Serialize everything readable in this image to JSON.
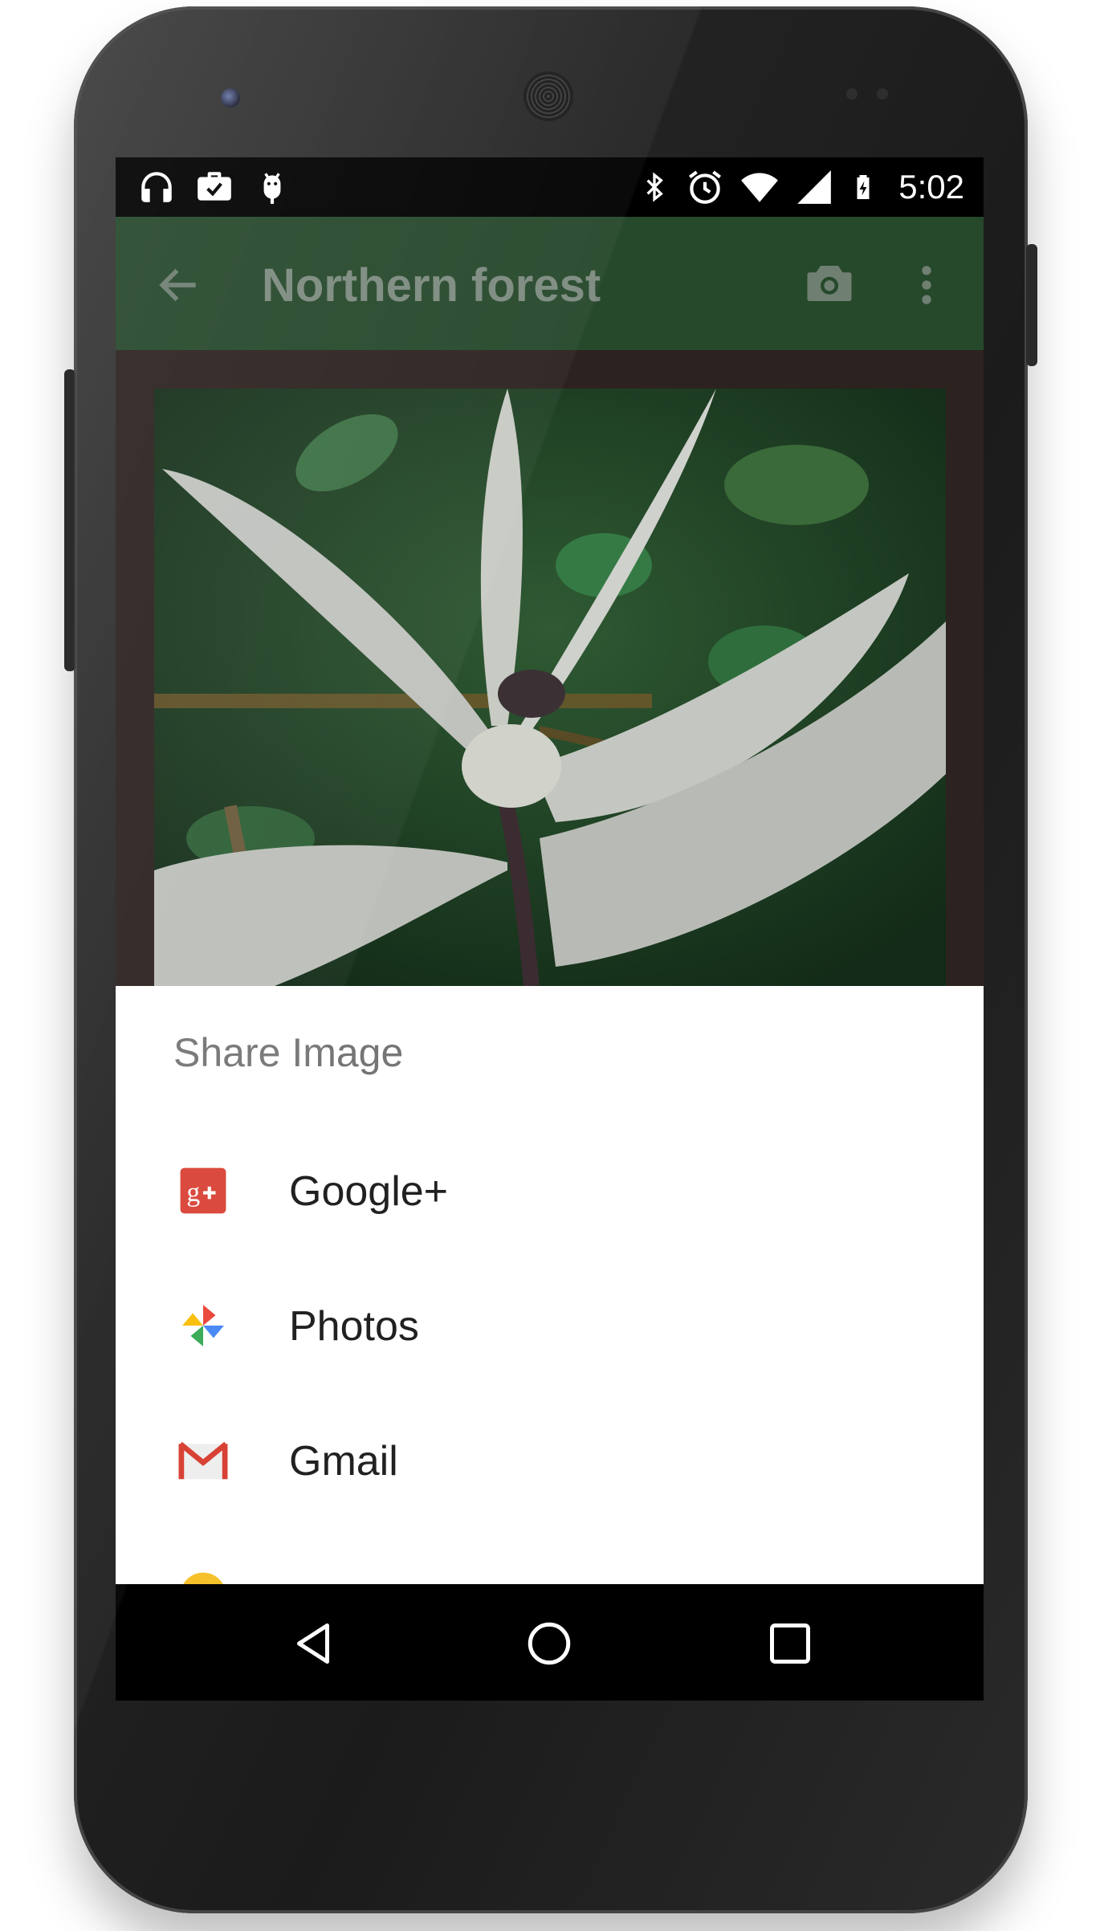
{
  "status_bar": {
    "time": "5:02",
    "left_icons": [
      "headphones-icon",
      "work-briefcase-icon",
      "android-debug-icon"
    ],
    "right_icons": [
      "bluetooth-icon",
      "alarm-icon",
      "wifi-icon",
      "signal-icon",
      "battery-charging-icon"
    ]
  },
  "app_bar": {
    "title": "Northern forest",
    "background": "#26482b"
  },
  "share_sheet": {
    "title": "Share Image",
    "items": [
      {
        "label": "Google+",
        "icon": "google-plus-icon"
      },
      {
        "label": "Photos",
        "icon": "photos-pinwheel-icon"
      },
      {
        "label": "Gmail",
        "icon": "gmail-icon"
      }
    ]
  },
  "nav_bar": {
    "buttons": [
      "back-triangle-icon",
      "home-circle-icon",
      "recents-square-icon"
    ]
  }
}
